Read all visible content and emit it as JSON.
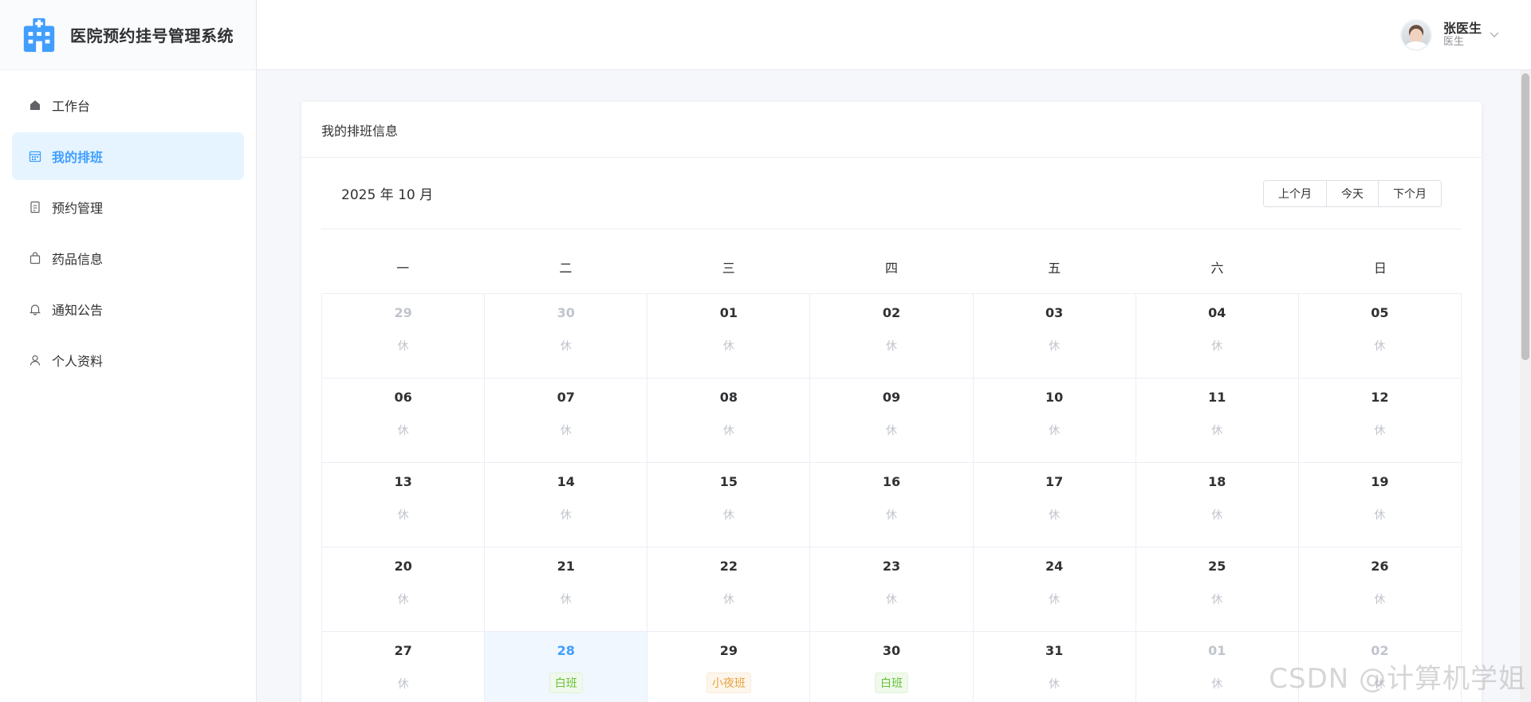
{
  "app": {
    "title": "医院预约挂号管理系统"
  },
  "sidebar": {
    "items": [
      {
        "label": "工作台",
        "icon": "home-icon",
        "active": false
      },
      {
        "label": "我的排班",
        "icon": "calendar-icon",
        "active": true
      },
      {
        "label": "预约管理",
        "icon": "document-icon",
        "active": false
      },
      {
        "label": "药品信息",
        "icon": "bag-icon",
        "active": false
      },
      {
        "label": "通知公告",
        "icon": "bell-icon",
        "active": false
      },
      {
        "label": "个人资料",
        "icon": "user-icon",
        "active": false
      }
    ]
  },
  "user": {
    "name": "张医生",
    "role": "医生"
  },
  "card": {
    "title": "我的排班信息"
  },
  "calendar": {
    "month_label": "2025 年 10 月",
    "buttons": {
      "prev": "上个月",
      "today": "今天",
      "next": "下个月"
    },
    "weekdays": [
      "一",
      "二",
      "三",
      "四",
      "五",
      "六",
      "日"
    ],
    "cells": [
      {
        "day": "29",
        "shift": "休",
        "other": true
      },
      {
        "day": "30",
        "shift": "休",
        "other": true
      },
      {
        "day": "01",
        "shift": "休"
      },
      {
        "day": "02",
        "shift": "休"
      },
      {
        "day": "03",
        "shift": "休"
      },
      {
        "day": "04",
        "shift": "休"
      },
      {
        "day": "05",
        "shift": "休"
      },
      {
        "day": "06",
        "shift": "休"
      },
      {
        "day": "07",
        "shift": "休"
      },
      {
        "day": "08",
        "shift": "休"
      },
      {
        "day": "09",
        "shift": "休"
      },
      {
        "day": "10",
        "shift": "休"
      },
      {
        "day": "11",
        "shift": "休"
      },
      {
        "day": "12",
        "shift": "休"
      },
      {
        "day": "13",
        "shift": "休"
      },
      {
        "day": "14",
        "shift": "休"
      },
      {
        "day": "15",
        "shift": "休"
      },
      {
        "day": "16",
        "shift": "休"
      },
      {
        "day": "17",
        "shift": "休"
      },
      {
        "day": "18",
        "shift": "休"
      },
      {
        "day": "19",
        "shift": "休"
      },
      {
        "day": "20",
        "shift": "休"
      },
      {
        "day": "21",
        "shift": "休"
      },
      {
        "day": "22",
        "shift": "休"
      },
      {
        "day": "23",
        "shift": "休"
      },
      {
        "day": "24",
        "shift": "休"
      },
      {
        "day": "25",
        "shift": "休"
      },
      {
        "day": "26",
        "shift": "休"
      },
      {
        "day": "27",
        "shift": "休"
      },
      {
        "day": "28",
        "shift": "白班",
        "tag": "white",
        "today": true
      },
      {
        "day": "29",
        "shift": "小夜班",
        "tag": "night"
      },
      {
        "day": "30",
        "shift": "白班",
        "tag": "white"
      },
      {
        "day": "31",
        "shift": "休"
      },
      {
        "day": "01",
        "shift": "休",
        "other": true
      },
      {
        "day": "02",
        "shift": "休",
        "other": true
      }
    ]
  },
  "watermark": "CSDN @计算机学姐",
  "colors": {
    "primary": "#409eff",
    "active_bg": "#e6f4ff",
    "white_shift": "#67c23a",
    "night_shift": "#e6a23c",
    "rest": "#c0c4cc"
  }
}
